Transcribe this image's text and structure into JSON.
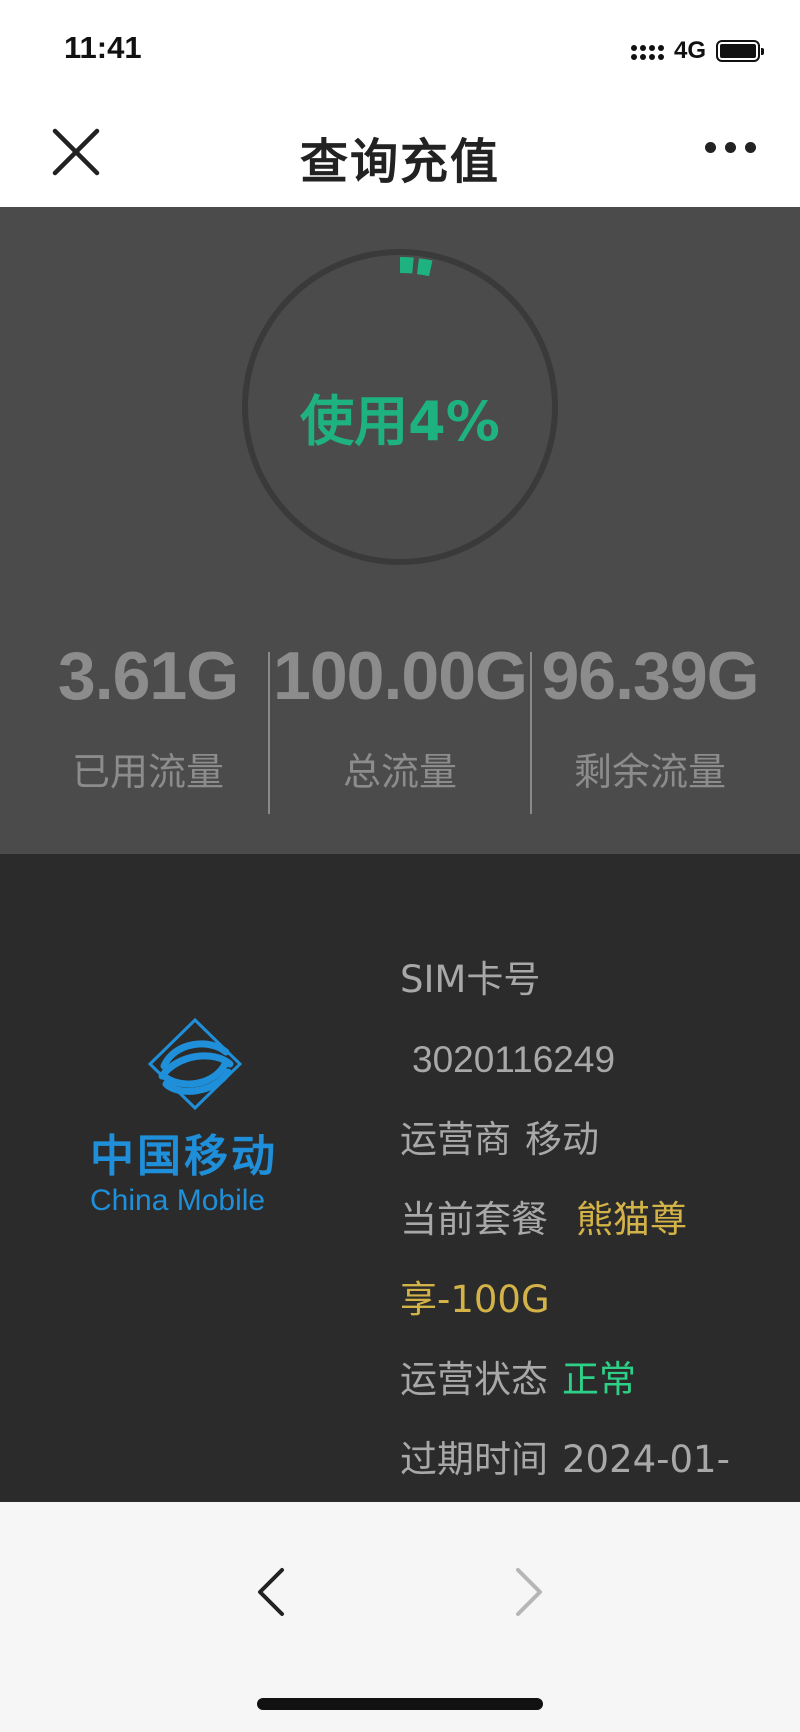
{
  "status_bar": {
    "time": "11:41",
    "network": "4G"
  },
  "nav": {
    "title": "查询充值",
    "close_icon": "close-icon",
    "more_icon": "more-icon"
  },
  "usage": {
    "ring_label": "使用4%",
    "percent_used": 4,
    "colors": {
      "ring_track": "#3a3a3a",
      "ring_progress": "#1fb281",
      "panel_bg": "#4b4b4b"
    },
    "stats": [
      {
        "value": "3.61G",
        "label": "已用流量"
      },
      {
        "value": "100.00G",
        "label": "总流量"
      },
      {
        "value": "96.39G",
        "label": "剩余流量"
      }
    ]
  },
  "carrier_logo": {
    "name_cn": "中国移动",
    "name_en": "China Mobile",
    "color": "#1f8fd9"
  },
  "sim_info": {
    "sim_label": "SIM卡号",
    "sim_number": "3020116249",
    "carrier_label": "运营商",
    "carrier_value": "移动",
    "plan_label": "当前套餐",
    "plan_value_part1": "熊猫尊",
    "plan_value_part2": "享-100G",
    "status_label": "运营状态",
    "status_value": "正常",
    "expiry_label": "过期时间",
    "expiry_value": "2024-01-",
    "colors": {
      "plan": "#d3b347",
      "status": "#2ecf86"
    }
  },
  "toolbar": {
    "back_icon": "chevron-left-icon",
    "forward_icon": "chevron-right-icon"
  }
}
